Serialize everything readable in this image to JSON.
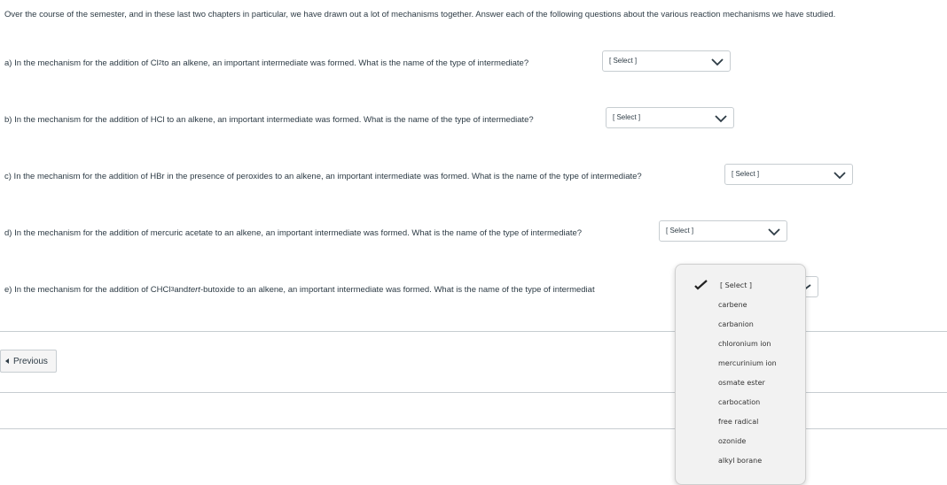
{
  "intro": "Over the course of the semester, and in these last two chapters in particular, we have drawn out a lot of mechanisms together.  Answer each of the following questions about the various reaction mechanisms we have studied.",
  "questions": [
    {
      "pre": "a)  In the mechanism for the addition of Cl",
      "sub": "2",
      "post": " to an alkene, an important intermediate was formed.  What is the name of the type of intermediate?",
      "selected": "[ Select ]"
    },
    {
      "text": "b)  In the mechanism for the addition of HCl to an alkene, an important intermediate was formed.  What is the name of the type of intermediate?",
      "selected": "[ Select ]"
    },
    {
      "text": "c)  In the mechanism for the addition of HBr in the presence of peroxides to an alkene, an important intermediate was formed.  What is the name of the type of intermediate?",
      "selected": "[ Select ]"
    },
    {
      "text": "d)  In the mechanism for the addition of mercuric acetate to an alkene, an important intermediate was formed.  What is the name of the type of intermediate?",
      "selected": "[ Select ]"
    },
    {
      "pre": "e)  In the mechanism for the addition of CHCl",
      "sub": "3",
      "mid": " and ",
      "ital": "tert",
      "post": "-butoxide to an alkene, an important intermediate was formed.  What is the name of the type of intermediat"
    }
  ],
  "dropdown": {
    "selected": "[ Select ]",
    "options": [
      "carbene",
      "carbanion",
      "chloronium ion",
      "mercurinium ion",
      "osmate ester",
      "carbocation",
      "free radical",
      "ozonide",
      "alkyl borane"
    ]
  },
  "nav": {
    "previous": "Previous"
  }
}
